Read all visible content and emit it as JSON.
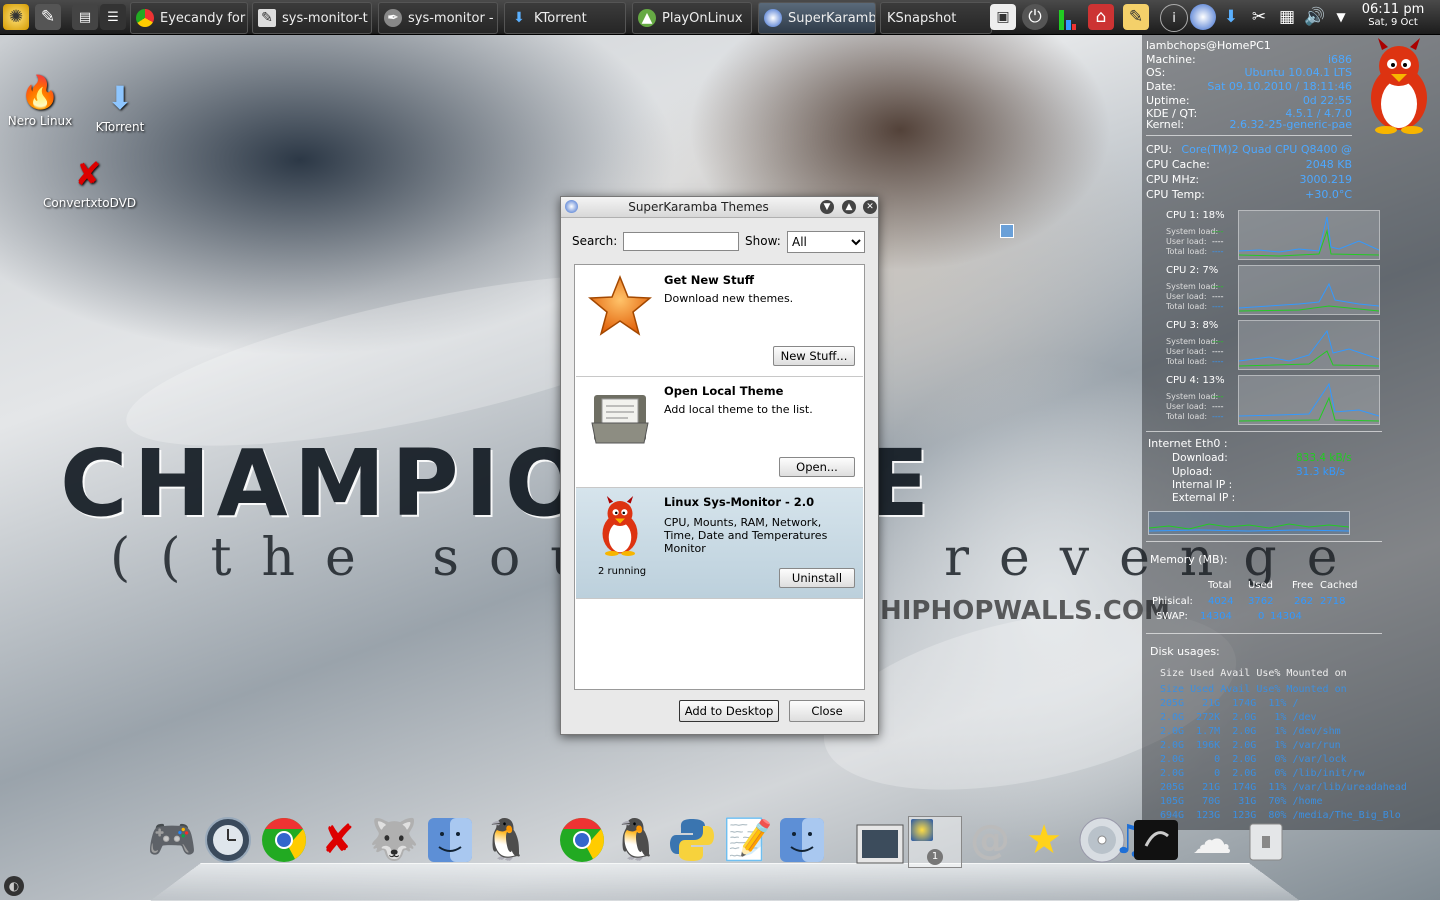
{
  "top_panel": {
    "tasks": [
      {
        "label": "Eyecandy for",
        "icon": "chrome-icon"
      },
      {
        "label": "sys-monitor-t",
        "icon": "notepad-icon"
      },
      {
        "label": "sys-monitor -",
        "icon": "tools-icon"
      },
      {
        "label": "KTorrent",
        "icon": "ktorrent-icon"
      },
      {
        "label": "PlayOnLinux",
        "icon": "playonlinux-icon"
      },
      {
        "label": "SuperKaramba",
        "icon": "superkaramba-icon"
      },
      {
        "label": "KSnapshot",
        "icon": "ksnapshot-icon"
      }
    ],
    "clock": {
      "time": "06:11 pm",
      "date": "Sat, 9 Oct"
    }
  },
  "desktop_icons": [
    {
      "label": "Nero Linux",
      "icon": "nero-icon"
    },
    {
      "label": "KTorrent",
      "icon": "ktorrent-icon"
    },
    {
      "label": "ConvertxtoDVD",
      "icon": "convertxtodvd-icon"
    }
  ],
  "wallpaper": {
    "title": "CHAMPIONAIRE",
    "subtitle": "((the sound of revenge",
    "site": "HIPHOPWALLS.COM"
  },
  "sysmon": {
    "user": "lambchops@HomePC1",
    "system": [
      {
        "label": "Machine:",
        "value": "i686"
      },
      {
        "label": "OS:",
        "value": "Ubuntu 10.04.1 LTS"
      },
      {
        "label": "Date:",
        "value": "Sat 09.10.2010 / 18:11:46"
      },
      {
        "label": "Uptime:",
        "value": "0d 22:55"
      },
      {
        "label": "KDE / QT:",
        "value": "4.5.1 / 4.7.0"
      },
      {
        "label": "Kernel:",
        "value": "2.6.32-25-generic-pae"
      }
    ],
    "cpu_info": [
      {
        "label": "CPU:",
        "value": "Core(TM)2 Quad CPU Q8400 @"
      },
      {
        "label": "CPU Cache:",
        "value": "2048 KB"
      },
      {
        "label": "CPU MHz:",
        "value": "3000.219"
      },
      {
        "label": "CPU Temp:",
        "value": "+30.0°C"
      }
    ],
    "cpus": [
      {
        "label": "CPU 1:",
        "percent": "18%"
      },
      {
        "label": "CPU 2:",
        "percent": "7%"
      },
      {
        "label": "CPU 3:",
        "percent": "8%"
      },
      {
        "label": "CPU 4:",
        "percent": "13%"
      }
    ],
    "load_labels": [
      "System load:",
      "User load:",
      "Total load:"
    ],
    "network": {
      "title": "Internet Eth0 :",
      "download_label": "Download:",
      "download": "833.4 kB/s",
      "upload_label": "Upload:",
      "upload": "31.3 kB/s",
      "internal_ip_label": "Internal IP :",
      "external_ip_label": "External IP :"
    },
    "memory": {
      "title": "Memory (MB):",
      "headers": [
        "Total",
        "Used",
        "Free",
        "Cached"
      ],
      "rows": [
        {
          "label": "Phisical:",
          "values": [
            "4024",
            "3762",
            "262",
            "2718"
          ]
        },
        {
          "label": "SWAP:",
          "values": [
            "14304",
            "0",
            "14304",
            ""
          ]
        }
      ]
    },
    "disk": {
      "title": "Disk usages:",
      "header": "Size Used Avail Use% Mounted on",
      "lines": [
        "Size Used Avail Use% Mounted on",
        "205G   21G  174G  11% /",
        "2.0G  272K  2.0G   1% /dev",
        "2.0G  1.7M  2.0G   1% /dev/shm",
        "2.0G  196K  2.0G   1% /var/run",
        "2.0G     0  2.0G   0% /var/lock",
        "2.0G     0  2.0G   0% /lib/init/rw",
        "205G   21G  174G  11% /var/lib/ureadahead",
        "105G   70G   31G  70% /home",
        "694G  123G  123G  80% /media/The_Big_Blo"
      ]
    }
  },
  "dialog": {
    "title": "SuperKaramba Themes",
    "search_label": "Search:",
    "search_value": "",
    "show_label": "Show:",
    "show_value": "All",
    "themes": [
      {
        "title": "Get New Stuff",
        "description": "Download new themes.",
        "status": "",
        "button": "New Stuff...",
        "icon": "star-icon"
      },
      {
        "title": "Open Local Theme",
        "description": "Add local theme to the list.",
        "status": "",
        "button": "Open...",
        "icon": "folder-icon"
      },
      {
        "title": "Linux Sys-Monitor - 2.0",
        "description": "CPU, Mounts, RAM, Network, Time, Date and Temperatures Monitor",
        "status": "2 running",
        "button": "Uninstall",
        "icon": "red-tux-icon"
      }
    ],
    "add_button": "Add to Desktop",
    "close_button": "Close"
  },
  "dock": {
    "icons": [
      "gamepad-icon",
      "time-machine-icon",
      "chrome-icon",
      "convertxtodvd-icon",
      "wolf-icon",
      "finder-icon",
      "tux-icon",
      "chrome-icon",
      "tux-icon",
      "python-icon",
      "text-editor-icon",
      "finder-icon",
      "desktop-switch-icon",
      "pager-icon",
      "at-mail-icon",
      "star-icon",
      "cd-music-icon",
      "itunes-icon",
      "dark-icon",
      "weather-icon",
      "trash-icon"
    ],
    "pager_number": "1"
  },
  "colors": {
    "accent": "#4da8ff",
    "graph_green": "#22cc22",
    "selected_row": "#c6d8e2"
  }
}
